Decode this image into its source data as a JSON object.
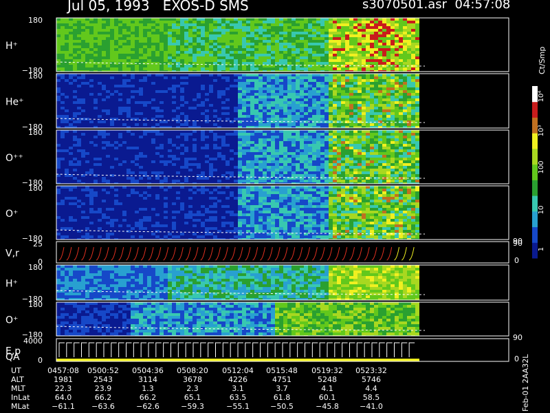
{
  "header": {
    "title_left": "Jul 05, 1993   EXOS-D SMS",
    "title_right": "s3070501.asr  04:57:08"
  },
  "footer_date": "Feb-01 2AA32L",
  "colorbar": {
    "label": "Ct/Smp",
    "ticks": [
      "10⁴",
      "10³",
      "100",
      "10",
      "1"
    ]
  },
  "chart_data": {
    "type": "heatmap",
    "panels": [
      {
        "name": "H⁺",
        "ytop": "180",
        "ybot": "−180"
      },
      {
        "name": "He⁺",
        "ytop": "180",
        "ybot": "−180"
      },
      {
        "name": "O⁺⁺",
        "ytop": "180",
        "ybot": "−180"
      },
      {
        "name": "O⁺",
        "ytop": "180",
        "ybot": "−180",
        "right_tick": "90"
      },
      {
        "name": "V,r",
        "ytop": "25",
        "ybot": "0",
        "right_top": "90",
        "right_bot": "0"
      },
      {
        "name": "H⁺",
        "ytop": "180",
        "ybot": "−180"
      },
      {
        "name": "O⁺",
        "ytop": "180",
        "ybot": "−180",
        "right_tick": "90"
      },
      {
        "name": "E,p",
        "ytop": "4000",
        "ybot": "0",
        "right_bot": "0",
        "sub": "QA"
      }
    ],
    "colors": [
      "#0a1a90",
      "#1648c8",
      "#28a0d0",
      "#38c8b0",
      "#2aa030",
      "#62c81c",
      "#a8d820",
      "#f0f020",
      "#c07020",
      "#c81c1c",
      "#ffffff"
    ],
    "table": {
      "rows": [
        {
          "label": "UT",
          "values": [
            "0457:08",
            "0500:52",
            "0504:36",
            "0508:20",
            "0512:04",
            "0515:48",
            "0519:32",
            "0523:32"
          ]
        },
        {
          "label": "ALT",
          "values": [
            "1981",
            "2543",
            "3114",
            "3678",
            "4226",
            "4751",
            "5248",
            "5746"
          ]
        },
        {
          "label": "MLT",
          "values": [
            "22.3",
            "23.9",
            "1.3",
            "2.3",
            "3.1",
            "3.7",
            "4.1",
            "4.4"
          ]
        },
        {
          "label": "InLat",
          "values": [
            "64.0",
            "66.2",
            "66.2",
            "65.1",
            "63.5",
            "61.8",
            "60.1",
            "58.5"
          ]
        },
        {
          "label": "MLat",
          "values": [
            "−61.1",
            "−63.6",
            "−62.6",
            "−59.3",
            "−55.1",
            "−50.5",
            "−45.8",
            "−41.0"
          ]
        }
      ]
    }
  }
}
